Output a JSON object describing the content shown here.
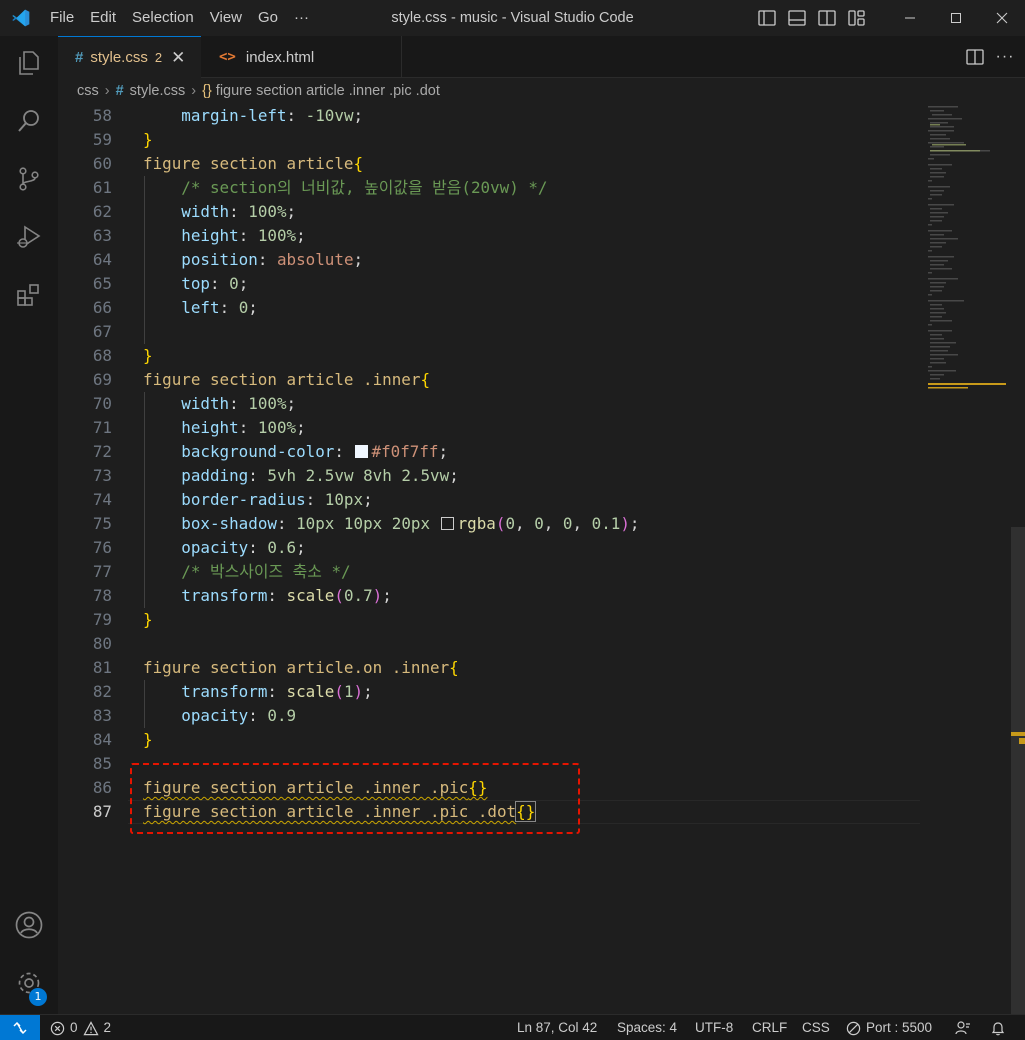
{
  "window": {
    "title": "style.css - music - Visual Studio Code"
  },
  "menu": [
    {
      "label": "File"
    },
    {
      "label": "Edit"
    },
    {
      "label": "Selection"
    },
    {
      "label": "View"
    },
    {
      "label": "Go"
    },
    {
      "label": "···"
    }
  ],
  "activity_bar": [
    {
      "icon": "files-icon"
    },
    {
      "icon": "search-icon"
    },
    {
      "icon": "source-control-icon"
    },
    {
      "icon": "run-debug-icon"
    },
    {
      "icon": "extensions-icon"
    },
    {
      "icon": "accounts-icon"
    },
    {
      "icon": "manage-gear-icon",
      "badge": "1"
    }
  ],
  "tabs": [
    {
      "label": "style.css",
      "problems": "2",
      "close": "✕",
      "active": true
    },
    {
      "label": "index.html",
      "active": false
    }
  ],
  "breadcrumb": {
    "folder": "css",
    "file": "style.css",
    "symbol": "figure section article .inner .pic .dot"
  },
  "editor": {
    "current_line": 87,
    "lines": [
      {
        "num": "58",
        "text": "    margin-left: -10vw;"
      },
      {
        "num": "59",
        "text": "}"
      },
      {
        "num": "60",
        "text": "figure section article{"
      },
      {
        "num": "61",
        "text": "    /* section의 너비값, 높이값을 받음(20vw) */"
      },
      {
        "num": "62",
        "text": "    width: 100%;"
      },
      {
        "num": "63",
        "text": "    height: 100%;"
      },
      {
        "num": "64",
        "text": "    position: absolute;"
      },
      {
        "num": "65",
        "text": "    top: 0;"
      },
      {
        "num": "66",
        "text": "    left: 0;"
      },
      {
        "num": "67",
        "text": ""
      },
      {
        "num": "68",
        "text": "}"
      },
      {
        "num": "69",
        "text": "figure section article .inner{"
      },
      {
        "num": "70",
        "text": "    width: 100%;"
      },
      {
        "num": "71",
        "text": "    height: 100%;"
      },
      {
        "num": "72",
        "text": "    background-color: #f0f7ff;"
      },
      {
        "num": "73",
        "text": "    padding: 5vh 2.5vw 8vh 2.5vw;"
      },
      {
        "num": "74",
        "text": "    border-radius: 10px;"
      },
      {
        "num": "75",
        "text": "    box-shadow: 10px 10px 20px rgba(0, 0, 0, 0.1);"
      },
      {
        "num": "76",
        "text": "    opacity: 0.6;"
      },
      {
        "num": "77",
        "text": "    /* 박스사이즈 축소 */"
      },
      {
        "num": "78",
        "text": "    transform: scale(0.7);"
      },
      {
        "num": "79",
        "text": "}"
      },
      {
        "num": "80",
        "text": ""
      },
      {
        "num": "81",
        "text": "figure section article.on .inner{"
      },
      {
        "num": "82",
        "text": "    transform: scale(1);"
      },
      {
        "num": "83",
        "text": "    opacity: 0.9"
      },
      {
        "num": "84",
        "text": "}"
      },
      {
        "num": "85",
        "text": ""
      },
      {
        "num": "86",
        "text": "figure section article .inner .pic{}"
      },
      {
        "num": "87",
        "text": "figure section article .inner .pic .dot{}"
      }
    ]
  },
  "status": {
    "errors": "0",
    "warnings": "2",
    "position": "Ln 87, Col 42",
    "spaces": "Spaces: 4",
    "encoding": "UTF-8",
    "eol": "CRLF",
    "language": "CSS",
    "port": "Port : 5500"
  },
  "colors": {
    "accent": "#0078d4",
    "highlight_box": "#e51400",
    "swatch_bg": "#f0f7ff"
  }
}
